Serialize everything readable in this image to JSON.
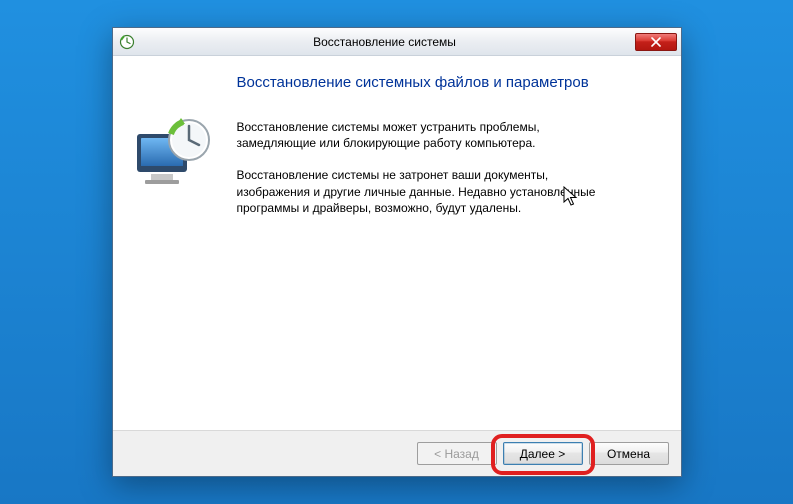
{
  "titlebar": {
    "title": "Восстановление системы"
  },
  "page": {
    "heading": "Восстановление системных файлов и параметров",
    "paragraph1": "Восстановление системы может устранить проблемы, замедляющие или блокирующие работу компьютера.",
    "paragraph2": "Восстановление системы не затронет ваши документы, изображения и другие личные данные. Недавно установленные программы и драйверы, возможно, будут удалены."
  },
  "footer": {
    "back_label": "< Назад",
    "next_label": "Далее >",
    "cancel_label": "Отмена"
  }
}
